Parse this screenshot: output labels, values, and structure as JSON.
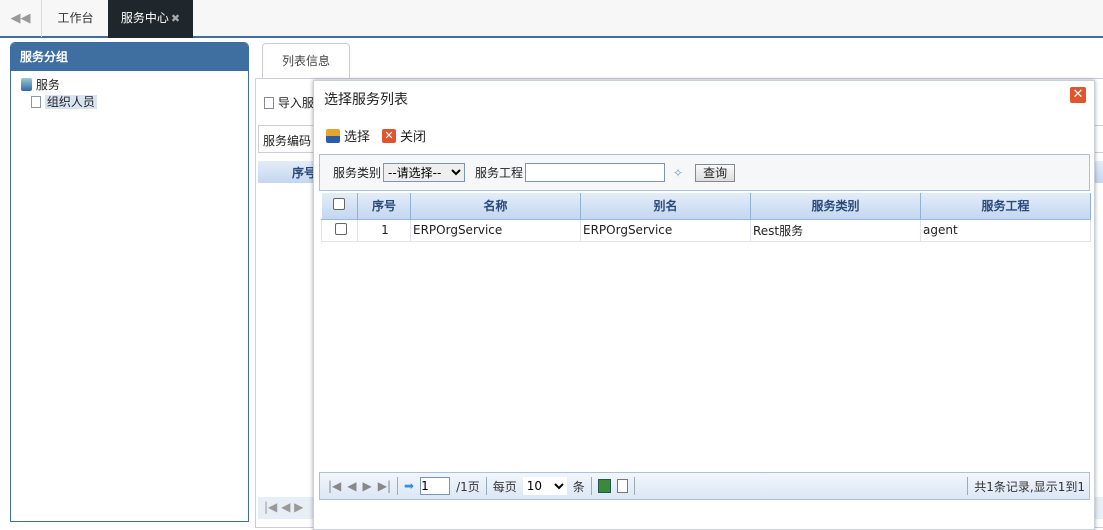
{
  "tabs": {
    "back": "◀◀",
    "workbench": "工作台",
    "service_center": "服务中心",
    "close": "✖"
  },
  "left": {
    "title": "服务分组",
    "root": "服务",
    "child": "组织人员"
  },
  "right": {
    "tab": "列表信息",
    "import": "导入服",
    "code_label": "服务编码",
    "seq": "序号"
  },
  "dialog": {
    "title": "选择服务列表",
    "select_btn": "选择",
    "close_btn": "关闭",
    "filter": {
      "type_label": "服务类别",
      "type_value": "--请选择--",
      "project_label": "服务工程",
      "project_value": "",
      "query": "查询"
    },
    "columns": [
      "序号",
      "名称",
      "别名",
      "服务类别",
      "服务工程"
    ],
    "rows": [
      {
        "seq": "1",
        "name": "ERPOrgService",
        "alias": "ERPOrgService",
        "type": "Rest服务",
        "project": "agent"
      }
    ],
    "pager": {
      "page": "1",
      "total_pages": "/1页",
      "per_page_label": "每页",
      "per_page": "10",
      "unit": "条",
      "summary": "共1条记录,显示1到1"
    }
  },
  "colors": {
    "accent": "#3f6fa0",
    "active_tab": "#1f272c",
    "close": "#e0552f"
  }
}
